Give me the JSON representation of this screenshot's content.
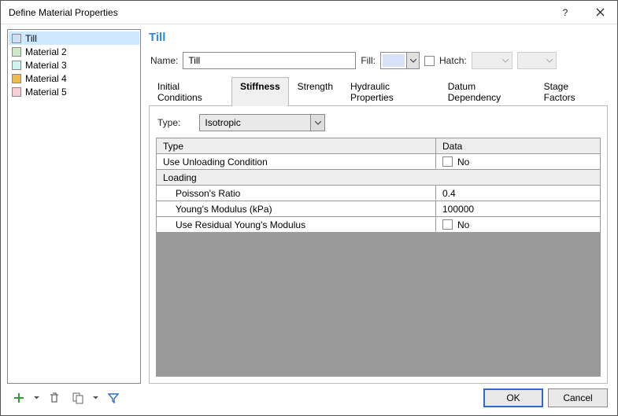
{
  "window": {
    "title": "Define Material Properties"
  },
  "sidebar": {
    "items": [
      {
        "label": "Till",
        "swatch": "#cde0f4",
        "selected": true
      },
      {
        "label": "Material 2",
        "swatch": "#cfe9c9",
        "selected": false
      },
      {
        "label": "Material 3",
        "swatch": "#cff3f1",
        "selected": false
      },
      {
        "label": "Material 4",
        "swatch": "#f0b94b",
        "selected": false
      },
      {
        "label": "Material 5",
        "swatch": "#f6cfd5",
        "selected": false
      }
    ]
  },
  "main": {
    "heading": "Till",
    "name_label": "Name:",
    "name_value": "Till",
    "fill_label": "Fill:",
    "fill_color": "#d7e1f7",
    "hatch_label": "Hatch:",
    "hatch_checked": false
  },
  "tabs": {
    "items": [
      {
        "label": "Initial Conditions",
        "active": false
      },
      {
        "label": "Stiffness",
        "active": true
      },
      {
        "label": "Strength",
        "active": false
      },
      {
        "label": "Hydraulic Properties",
        "active": false
      },
      {
        "label": "Datum Dependency",
        "active": false
      },
      {
        "label": "Stage Factors",
        "active": false
      }
    ]
  },
  "type_row": {
    "label": "Type:",
    "value": "Isotropic"
  },
  "grid": {
    "headers": {
      "c1": "Type",
      "c2": "Data"
    },
    "rows": [
      {
        "kind": "row",
        "c1": "Use Unloading Condition",
        "c2": "No",
        "checkbox": true
      },
      {
        "kind": "section",
        "c1": "Loading"
      },
      {
        "kind": "sub",
        "c1": "Poisson's Ratio",
        "c2": "0.4"
      },
      {
        "kind": "sub",
        "c1": "Young's Modulus (kPa)",
        "c2": "100000"
      },
      {
        "kind": "sub",
        "c1": "Use Residual Young's Modulus",
        "c2": "No",
        "checkbox": true
      }
    ]
  },
  "buttons": {
    "ok": "OK",
    "cancel": "Cancel"
  }
}
